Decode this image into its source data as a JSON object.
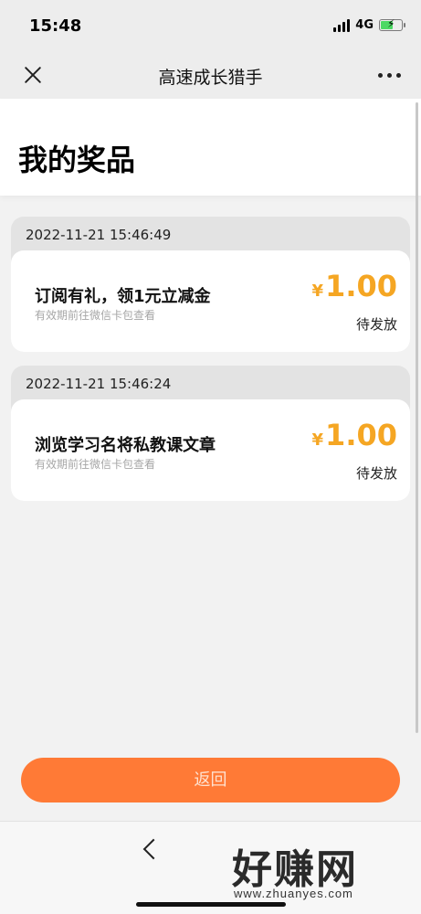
{
  "status_bar": {
    "time": "15:48",
    "network": "4G",
    "battery_level": 0.6
  },
  "nav": {
    "title": "高速成长猎手",
    "close_icon": "close-icon",
    "more_icon": "more-icon"
  },
  "page": {
    "title": "我的奖品"
  },
  "prizes": [
    {
      "date": "2022-11-21 15:46:49",
      "name": "订阅有礼，领1元立减金",
      "note": "有效期前往微信卡包查看",
      "currency": "¥",
      "amount": "1.00",
      "status": "待发放"
    },
    {
      "date": "2022-11-21 15:46:24",
      "name": "浏览学习名将私教课文章",
      "note": "有效期前往微信卡包查看",
      "currency": "¥",
      "amount": "1.00",
      "status": "待发放"
    }
  ],
  "actions": {
    "return_label": "返回"
  },
  "colors": {
    "accent": "#ff7a36",
    "amount": "#f5a623"
  },
  "watermark": {
    "logo": "好赚网",
    "url": "www.zhuanyes.com"
  }
}
